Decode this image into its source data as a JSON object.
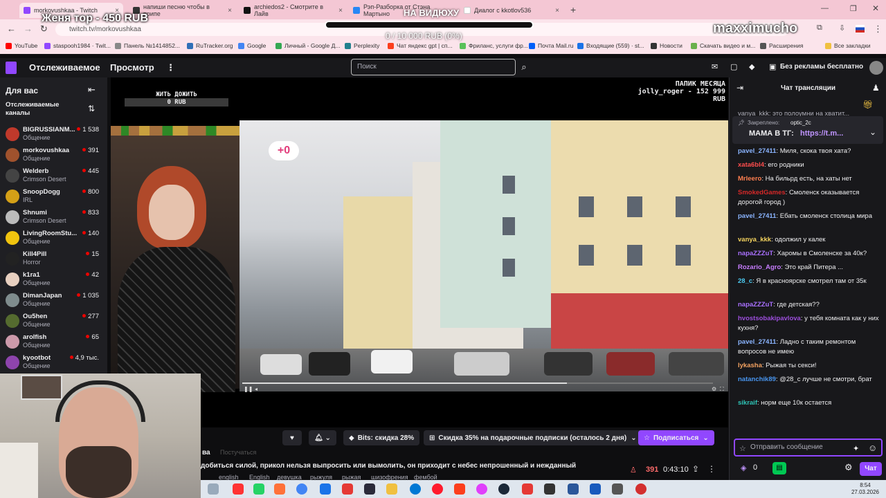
{
  "browser": {
    "tabs": [
      {
        "label": "morkovushkaa - Twitch",
        "color": "#9147ff"
      },
      {
        "label": "напиши песню чтобы в припе",
        "color": "#333333"
      },
      {
        "label": "archiedos2 - Смотрите в Лайв",
        "color": "#111111"
      },
      {
        "label": "Рэп-Разборка от Стэна Мартыно",
        "color": "#2787f5"
      },
      {
        "label": "Диалог с kkotlov536",
        "color": "#ffffff"
      }
    ],
    "url": "twitch.tv/morkovushkaa",
    "bookmarks": [
      "YouTube",
      "staspooh1984 · Twit...",
      "Панель №1414852...",
      "RuTracker.org",
      "Google",
      "Личный - Google Д...",
      "Perplexity",
      "Чат яндекс gpt | сп...",
      "Фриланс, услуги фр...",
      "Почта Mail.ru",
      "Входящие (559) · st...",
      "Новости",
      "Скачать видео и м...",
      "Расширения",
      "Все закладки"
    ]
  },
  "overlay": {
    "donor": "Женя тор - 450 RUB",
    "bar_label": "НА ВИДЮХУ",
    "bar_value": "0 / 10 000 RUB (0%)",
    "bar_progress": 0,
    "watermark": "maxximucho"
  },
  "twitch": {
    "nav_following": "Отслеживаемое",
    "nav_browse": "Просмотр",
    "search_placeholder": "Поиск",
    "no_ads": "Без рекламы бесплатно"
  },
  "sidebar": {
    "title": "Для вас",
    "subtitle": "Отслеживаемые каналы",
    "channels": [
      {
        "name": "BIGRUSSIANM...",
        "category": "Общение",
        "viewers": "1 538",
        "color": "#c0392b"
      },
      {
        "name": "morkovushkaa",
        "category": "Общение",
        "viewers": "391",
        "color": "#a0522d"
      },
      {
        "name": "Welderb",
        "category": "Crimson Desert",
        "viewers": "445",
        "color": "#444444"
      },
      {
        "name": "SnoopDogg",
        "category": "IRL",
        "viewers": "800",
        "color": "#d4a017"
      },
      {
        "name": "Shnumi",
        "category": "Crimson Desert",
        "viewers": "833",
        "color": "#bbbbbb"
      },
      {
        "name": "LivingRoomStu...",
        "category": "Общение",
        "viewers": "140",
        "color": "#f1c40f"
      },
      {
        "name": "Kill4Pill",
        "category": "Horror",
        "viewers": "15",
        "color": "#222222"
      },
      {
        "name": "k1ra1",
        "category": "Общение",
        "viewers": "42",
        "color": "#e8d0c0"
      },
      {
        "name": "DimanJapan",
        "category": "Общение",
        "viewers": "1 035",
        "color": "#7f8c8d"
      },
      {
        "name": "Ou5hen",
        "category": "Общение",
        "viewers": "277",
        "color": "#556b2f"
      },
      {
        "name": "arolfish",
        "category": "Общение",
        "viewers": "65",
        "color": "#cc99aa"
      },
      {
        "name": "kyootbot",
        "category": "Общение",
        "viewers": "4,9 тыс.",
        "color": "#8e44ad"
      }
    ]
  },
  "video": {
    "goal_title": "ЖИТЬ ДОЖИТЬ",
    "goal_value": "0 RUB",
    "papik_title": "ПАПИК МЕСЯЦА",
    "papik_user": "jolly_roger - 152 999",
    "papik_unit": "RUB",
    "progress": 0.69
  },
  "info": {
    "bits": "Bits: скидка 28%",
    "gift": "Скидка 35% на подарочные подписки (осталось 2 дня)",
    "subscribe": "Подписаться",
    "description": "добиться силой, прикол нельзя выпросить или вымолить, он приходит с небес непрошенный и нежданный",
    "tags": [
      "english",
      "English",
      "девушка",
      "рыжуля",
      "рыжая",
      "шизофрения",
      "фембой"
    ],
    "viewers": "391",
    "uptime": "0:43:10",
    "partial_name": "ва",
    "following_btn": "Постучаться"
  },
  "chat": {
    "title": "Чат трансляции",
    "pinned_label": "Закреплено:",
    "pinned_user": "optic_2c",
    "pinned_text": "МАМА В ТГ:",
    "pinned_link": "https://t.m...",
    "top_partial": "vanya_kkk: это полоумни на хватит...",
    "messages": [
      {
        "user": "pavel_27411",
        "color": "#8ab4ff",
        "text": "Миля, скока твоя хата?"
      },
      {
        "user": "xata6bl4",
        "color": "#ff4d4d",
        "text": "его родники"
      },
      {
        "user": "Mrleero",
        "color": "#ff7f50",
        "text": "На бильрд есть, на хаты нет"
      },
      {
        "user": "SmokedGames",
        "color": "#d62828",
        "text": "Смоленск оказывается дорогой город )"
      },
      {
        "user": "pavel_27411",
        "color": "#8ab4ff",
        "text": "Ебать смоленск столица мира"
      },
      {
        "user": "vanya_kkk",
        "color": "#f4d35e",
        "text": "одолжил у калек"
      },
      {
        "user": "napaZZZuT",
        "color": "#a970ff",
        "text": "Харомы в Смоленске за 40к?"
      },
      {
        "user": "Rozario_Agro",
        "color": "#c77dff",
        "text": "Это край Питера ..."
      },
      {
        "user": "28_c",
        "color": "#4cc9f0",
        "text": "Я в красноярске смотрел там от 35к"
      },
      {
        "user": "napaZZZuT",
        "color": "#a970ff",
        "text": "где детская??"
      },
      {
        "user": "hvostsobakipavlova",
        "color": "#9d4edd",
        "text": "у тебя комната как у них кухня?"
      },
      {
        "user": "pavel_27411",
        "color": "#8ab4ff",
        "text": "Ладно с таким ремонтом вопросов не имею"
      },
      {
        "user": "lykasha",
        "color": "#f4a261",
        "text": "Рыжая ты секси!"
      },
      {
        "user": "natanchik89",
        "color": "#4895ef",
        "text": "@28_c лучше не смотри, брат"
      },
      {
        "user": "sikraif",
        "color": "#2ec4b6",
        "text": "норм еще 10к остается"
      }
    ],
    "input_placeholder": "Отправить сообщение",
    "points": "0",
    "send_label": "Чат"
  },
  "taskbar": {
    "time": "8:54",
    "date": "27.03.2026"
  }
}
